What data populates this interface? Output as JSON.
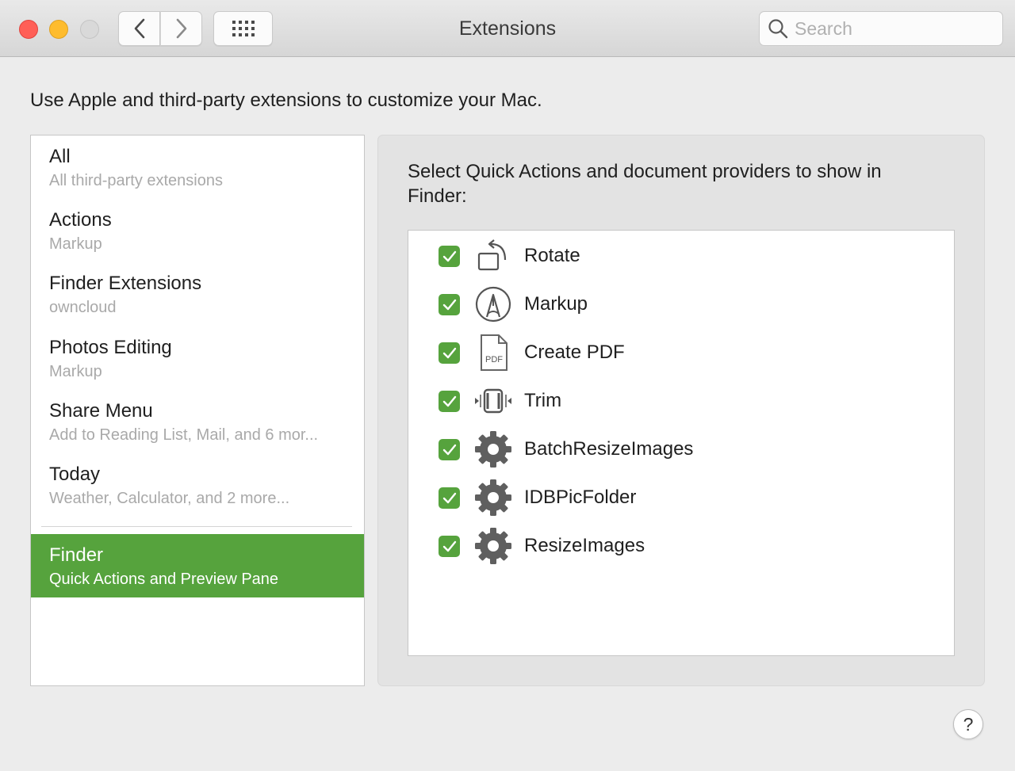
{
  "window": {
    "title": "Extensions"
  },
  "search": {
    "placeholder": "Search"
  },
  "description": "Use Apple and third-party extensions to customize your Mac.",
  "sidebar": {
    "items": [
      {
        "name": "All",
        "subtitle": "All third-party extensions"
      },
      {
        "name": "Actions",
        "subtitle": "Markup"
      },
      {
        "name": "Finder Extensions",
        "subtitle": "owncloud"
      },
      {
        "name": "Photos Editing",
        "subtitle": "Markup"
      },
      {
        "name": "Share Menu",
        "subtitle": "Add to Reading List, Mail, and 6 mor..."
      },
      {
        "name": "Today",
        "subtitle": "Weather, Calculator, and 2 more..."
      },
      {
        "name": "Finder",
        "subtitle": "Quick Actions and Preview Pane"
      }
    ],
    "selected_index": 6
  },
  "panel": {
    "heading": "Select Quick Actions and document providers to show in Finder:",
    "actions": [
      {
        "label": "Rotate",
        "checked": true,
        "icon": "rotate-icon"
      },
      {
        "label": "Markup",
        "checked": true,
        "icon": "markup-icon"
      },
      {
        "label": "Create PDF",
        "checked": true,
        "icon": "pdf-document-icon",
        "icon_text": "PDF"
      },
      {
        "label": "Trim",
        "checked": true,
        "icon": "trim-icon"
      },
      {
        "label": "BatchResizeImages",
        "checked": true,
        "icon": "gear-icon"
      },
      {
        "label": "IDBPicFolder",
        "checked": true,
        "icon": "gear-icon"
      },
      {
        "label": "ResizeImages",
        "checked": true,
        "icon": "gear-icon"
      }
    ]
  },
  "help": {
    "label": "?"
  },
  "colors": {
    "accent": "#56a33d",
    "close": "#ff5f57",
    "minimize": "#febc2e"
  }
}
